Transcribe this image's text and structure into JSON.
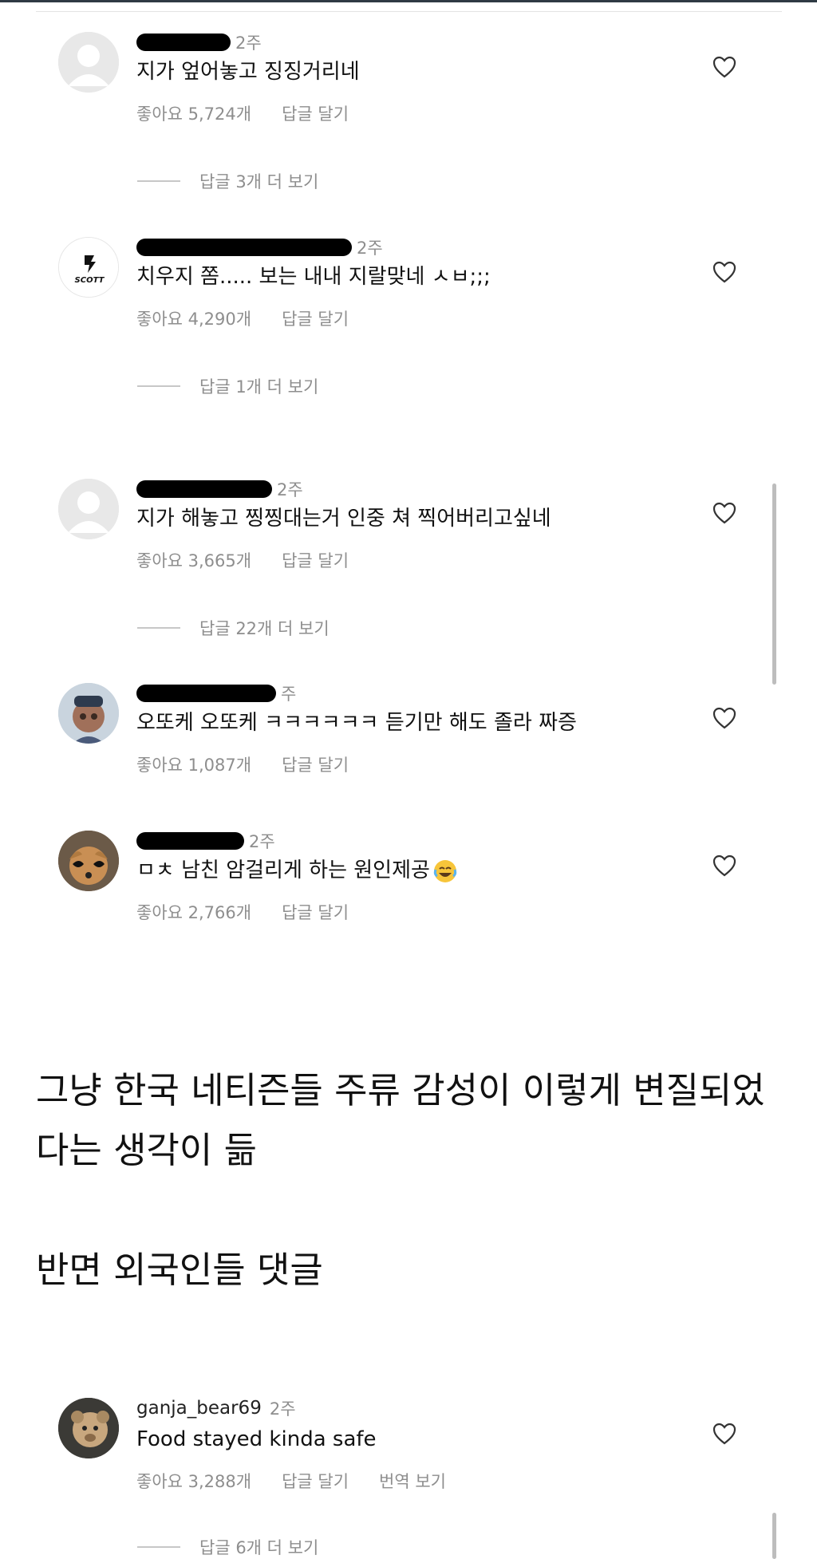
{
  "comments": [
    {
      "time": "2주",
      "text": "지가 엎어놓고 징징거리네",
      "likes": "좋아요 5,724개",
      "reply": "답글 달기",
      "more": "답글 3개 더 보기"
    },
    {
      "time": "2주",
      "text": "치우지 쫌..... 보는 내내 지랄맞네 ㅅㅂ;;;",
      "likes": "좋아요 4,290개",
      "reply": "답글 달기",
      "more": "답글 1개 더 보기",
      "avatar_text": "SCOTT"
    },
    {
      "time": "2주",
      "text": "지가 해놓고 찡찡대는거 인중 쳐 찍어버리고싶네",
      "likes": "좋아요 3,665개",
      "reply": "답글 달기",
      "more": "답글 22개 더 보기"
    },
    {
      "time": "주",
      "text": "오또케 오또케 ㅋㅋㅋㅋㅋㅋ 듣기만 해도 졸라 짜증",
      "likes": "좋아요 1,087개",
      "reply": "답글 달기"
    },
    {
      "time": "2주",
      "text": "ㅁㅊ 남친 암걸리게 하는 원인제공",
      "likes": "좋아요 2,766개",
      "reply": "답글 달기",
      "emoji": "face-with-tears-of-joy"
    }
  ],
  "article": {
    "line1": "그냥 한국 네티즌들 주류 감성이 이렇게 변질되었",
    "line2": "다는 생각이 듦",
    "line3": "반면 외국인들 댓글"
  },
  "foreign_comment": {
    "username": "ganja_bear69",
    "time": "2주",
    "text": "Food stayed kinda safe",
    "likes": "좋아요 3,288개",
    "reply": "답글 달기",
    "translate": "번역 보기",
    "more": "답글 6개 더 보기"
  },
  "icons": {
    "like": "heart-outline-icon",
    "default_avatar": "default-avatar-icon"
  },
  "colors": {
    "meta_text": "#8e8e8e",
    "text": "#111111",
    "scrollbar": "#bdbdbd"
  }
}
